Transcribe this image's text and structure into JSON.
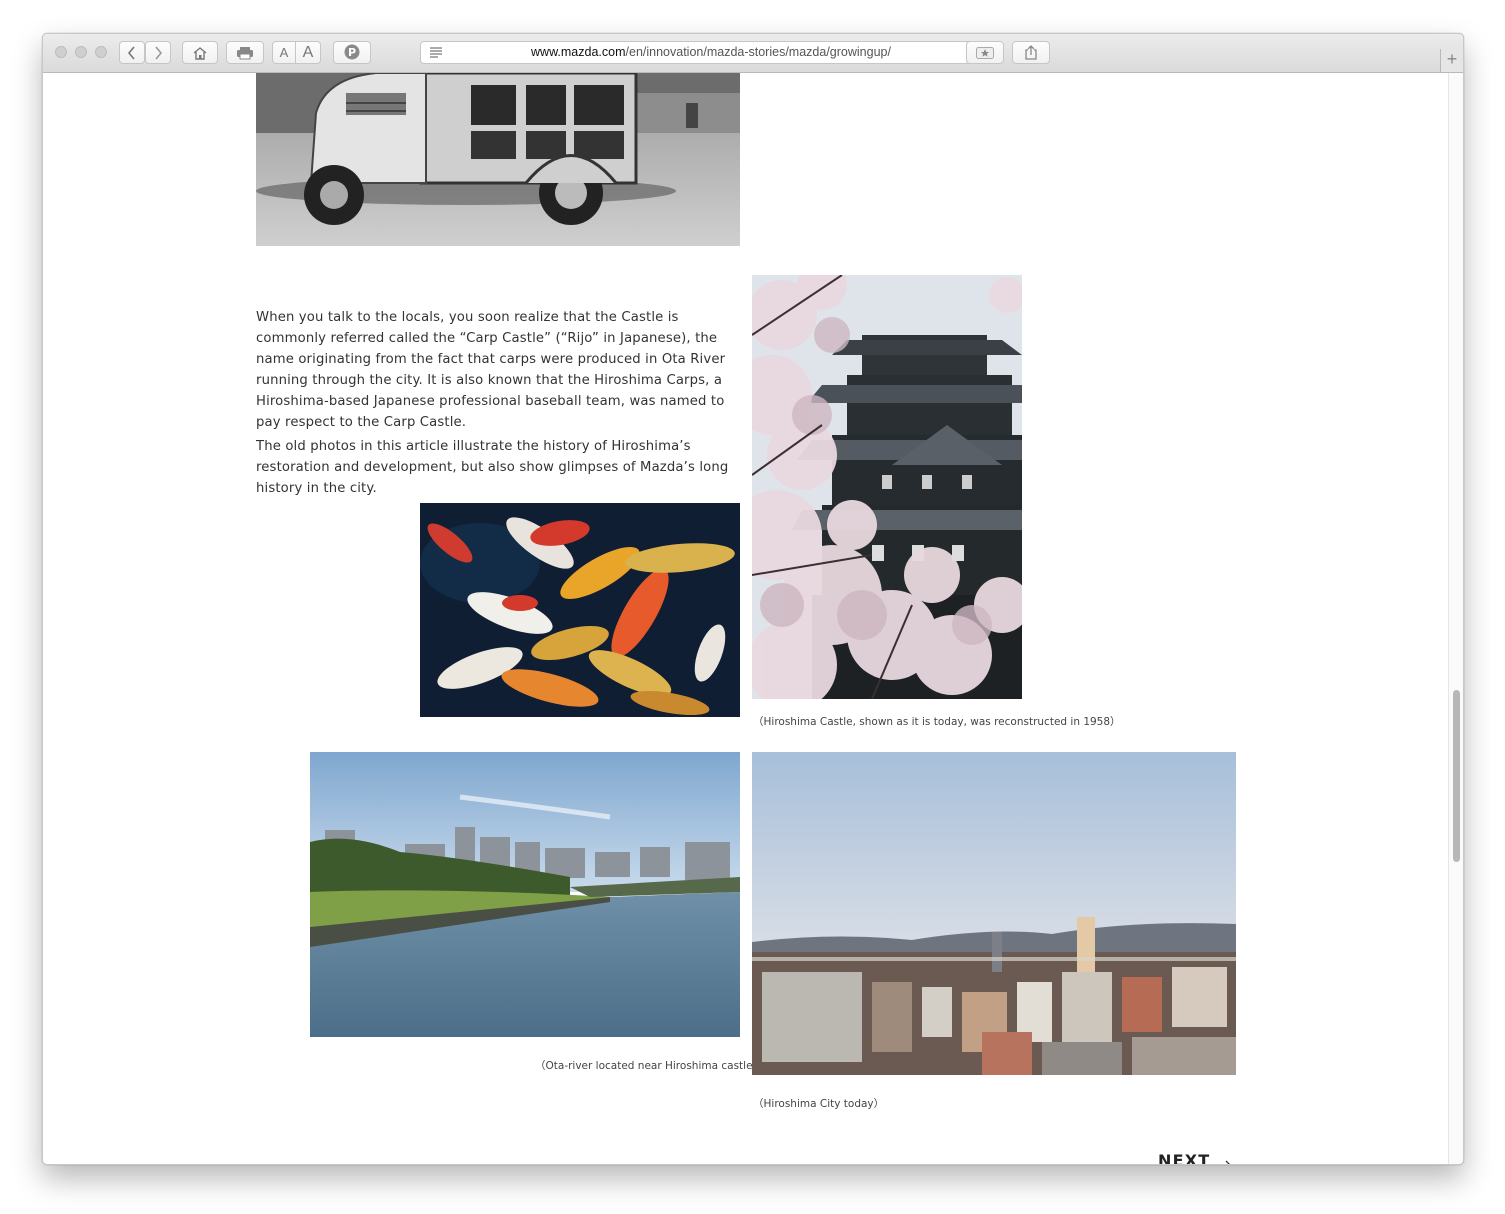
{
  "browser": {
    "url_domain": "www.mazda.com",
    "url_path": "/en/innovation/mazda-stories/mazda/growingup/",
    "text_size_small": "A",
    "text_size_large": "A",
    "new_tab": "+"
  },
  "article": {
    "paragraph_1": "When you talk to the locals, you soon realize that the Castle is commonly referred called the “Carp Castle” (“Rijo” in Japanese), the name originating from the fact that carps were produced in Ota River running through the city. It is also known that the Hiroshima Carps, a Hiroshima-based Japanese professional baseball team, was named to pay respect to the Carp Castle.",
    "paragraph_2": "The old photos in this article illustrate the history of Hiroshima’s restoration and development, but also show glimpses of Mazda’s long history in the city.",
    "caption_castle": "（Hiroshima Castle, shown as it is today, was reconstructed in 1958）",
    "caption_river": "（Ota-river located near Hiroshima castle）",
    "caption_city": "（Hiroshima City today）",
    "next_label": "NEXT"
  }
}
